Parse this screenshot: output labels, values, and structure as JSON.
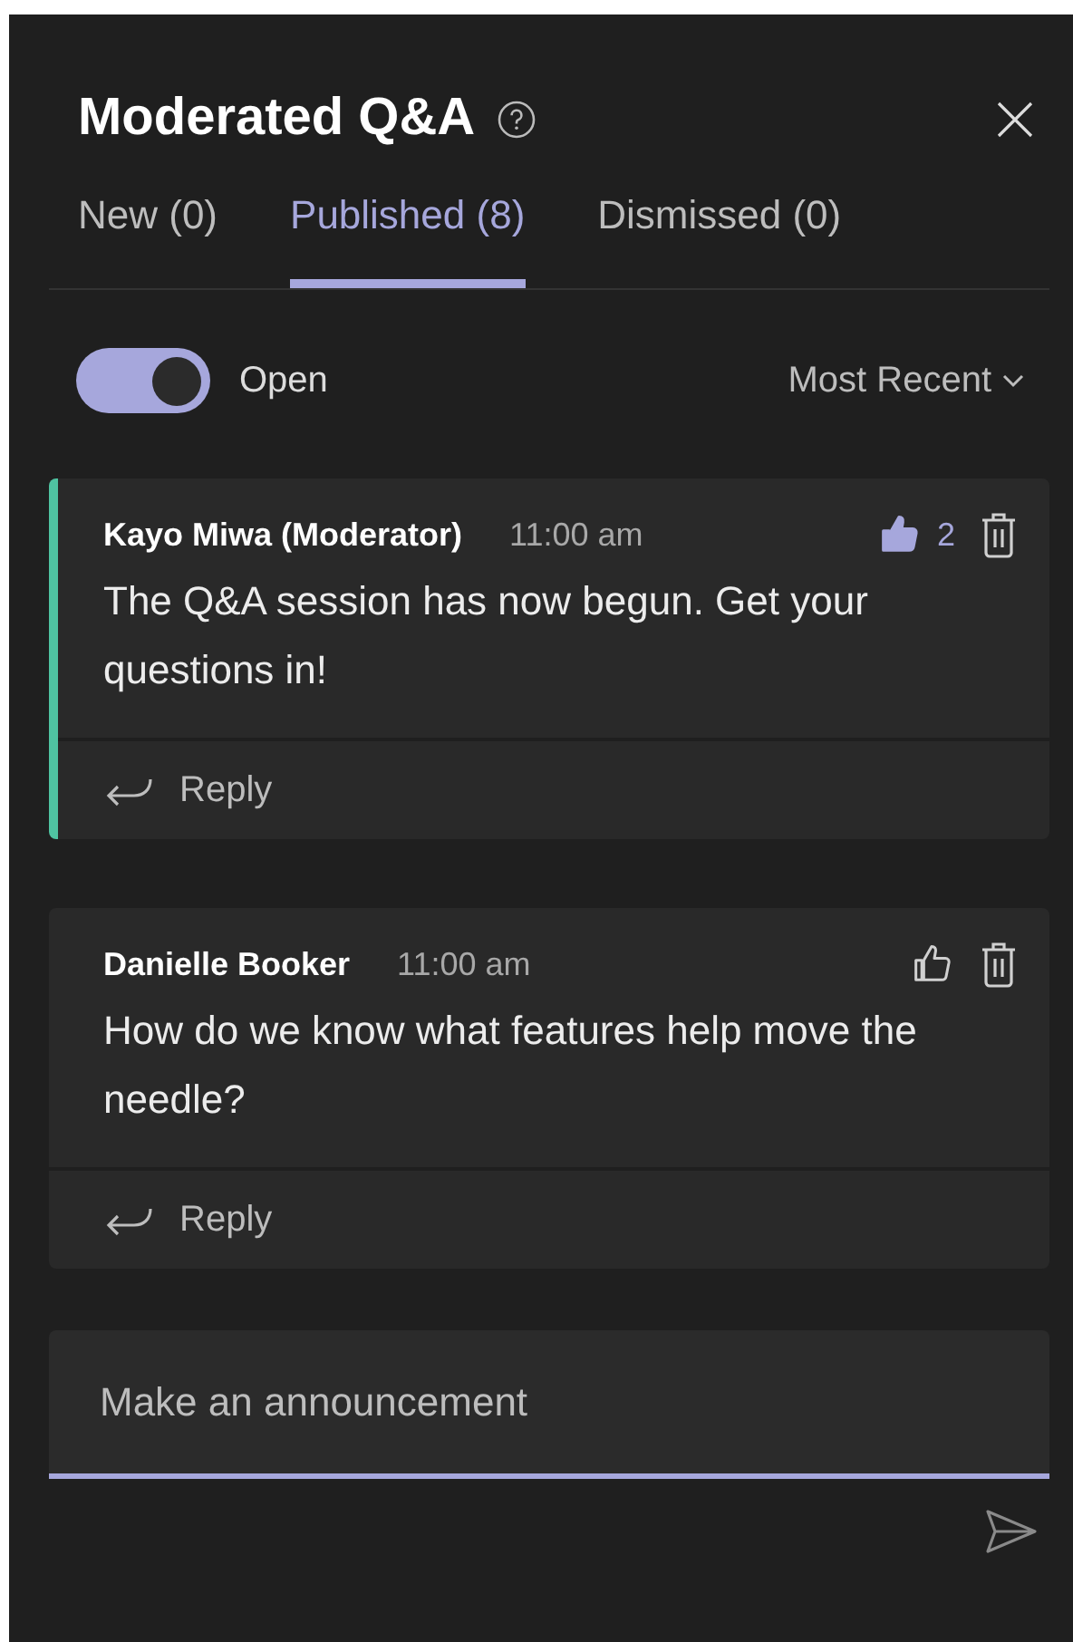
{
  "header": {
    "title": "Moderated Q&A"
  },
  "tabs": [
    {
      "label": "New (0)",
      "selected": false
    },
    {
      "label": "Published (8)",
      "selected": true
    },
    {
      "label": "Dismissed (0)",
      "selected": false
    }
  ],
  "toggle": {
    "label": "Open",
    "on": true
  },
  "sort": {
    "label": "Most Recent"
  },
  "posts": [
    {
      "author": "Kayo Miwa (Moderator)",
      "time": "11:00 am",
      "text": "The Q&A session has now begun. Get your questions in!",
      "liked": true,
      "like_count": "2",
      "highlighted": true,
      "reply": "Reply"
    },
    {
      "author": "Danielle Booker",
      "time": "11:00 am",
      "text": "How do we know what features help move the needle?",
      "liked": false,
      "highlighted": false,
      "reply": "Reply"
    }
  ],
  "composer": {
    "placeholder": "Make an announcement"
  }
}
